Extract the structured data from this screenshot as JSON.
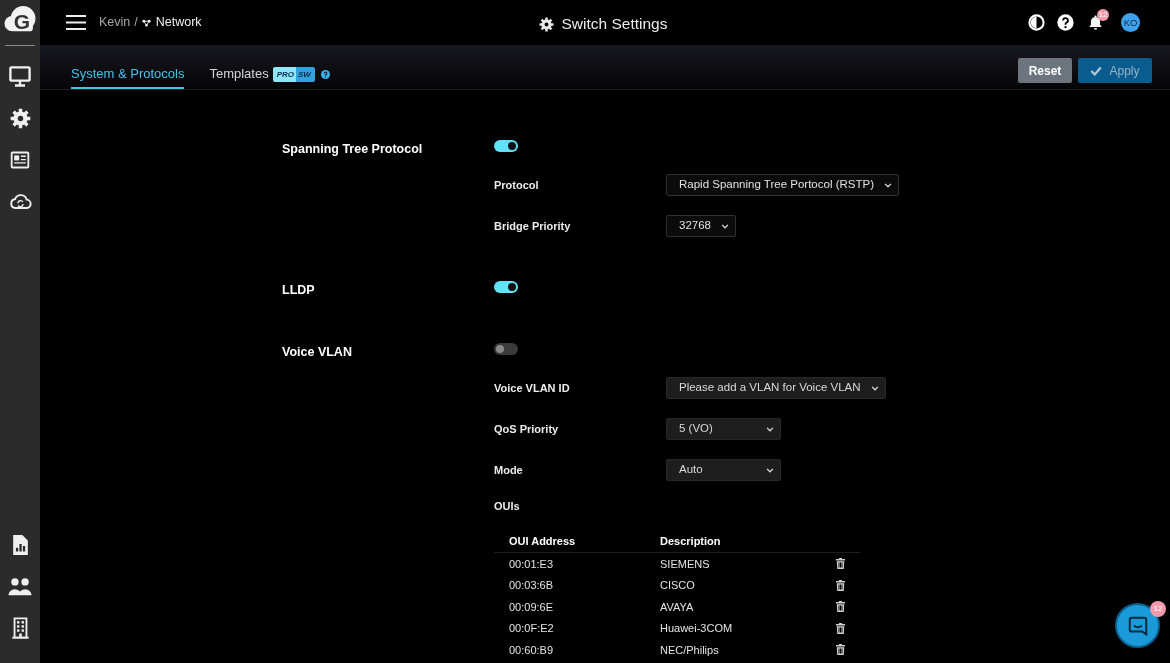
{
  "logo": {
    "letter": "G"
  },
  "header": {
    "breadcrumb": [
      {
        "label": "Kevin",
        "kind": "parent"
      },
      {
        "label": "Network",
        "kind": "current"
      }
    ],
    "separator": "/",
    "title": "Switch Settings",
    "notification_count": "12",
    "avatar_initials": "KO"
  },
  "tabs": [
    {
      "label": "System & Protocols",
      "selected": true
    },
    {
      "label": "Templates",
      "selected": false,
      "badges": [
        "PRO",
        "SW"
      ]
    }
  ],
  "actions": [
    {
      "label": "Reset",
      "kind": "secondary",
      "disabled": false
    },
    {
      "label": "Apply",
      "kind": "primary",
      "disabled": true
    }
  ],
  "settings": [
    {
      "label": "Spanning Tree Protocol",
      "on": true,
      "fields": [
        {
          "label": "Protocol",
          "value": "Rapid Spanning Tree Portocol (RSTP)",
          "disabled": false
        },
        {
          "label": "Bridge Priority",
          "value": "32768",
          "disabled": false
        }
      ]
    },
    {
      "label": "LLDP",
      "on": true
    },
    {
      "label": "Voice VLAN",
      "on": false,
      "fields": [
        {
          "label": "Voice VLAN ID",
          "value": "Please add a VLAN for Voice VLAN",
          "disabled": true
        },
        {
          "label": "QoS Priority",
          "value": "5 (VO)",
          "disabled": true
        },
        {
          "label": "Mode",
          "value": "Auto",
          "disabled": true
        }
      ],
      "ouis": {
        "label": "OUIs",
        "columns": [
          "OUI Address",
          "Description"
        ],
        "rows": [
          {
            "address": "00:01:E3",
            "description": "SIEMENS"
          },
          {
            "address": "00:03:6B",
            "description": "CISCO"
          },
          {
            "address": "00:09:6E",
            "description": "AVAYA"
          },
          {
            "address": "00:0F:E2",
            "description": "Huawei-3COM"
          },
          {
            "address": "00:60:B9",
            "description": "NEC/Philips"
          }
        ]
      }
    }
  ],
  "chat": {
    "badge": "12"
  }
}
